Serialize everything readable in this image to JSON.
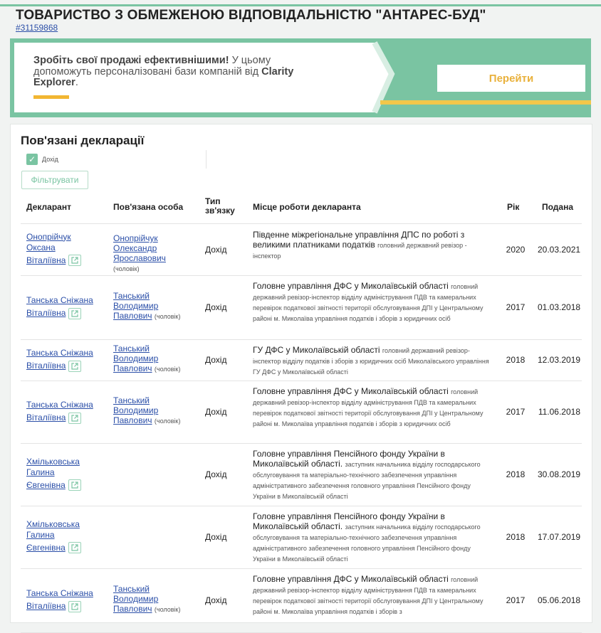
{
  "company": {
    "title": "ТОВАРИСТВО З ОБМЕЖЕНОЮ ВІДПОВІДАЛЬНІСТЮ \"АНТАРЕС-БУД\"",
    "id": "#31159868"
  },
  "banner": {
    "headline": "Зробіть свої продажі ефективнішими!",
    "text": "У цьому допоможуть персоналізовані бази компаній від",
    "brand": "Clarity Explorer",
    "period": ".",
    "button_label": "Перейти"
  },
  "panel": {
    "title": "Пов'язані декларації",
    "filter_checkbox_label": "Дохід",
    "filter_button_label": "Фільтрувати"
  },
  "table": {
    "headers": {
      "declarant": "Декларант",
      "related": "Пов'язана особа",
      "type": "Тип зв'язку",
      "workplace": "Місце роботи декларанта",
      "year": "Рік",
      "submitted": "Подана"
    },
    "rows": [
      {
        "declarant": [
          "Онопрійчук",
          "Оксана",
          "Віталіївна"
        ],
        "related": [
          "Онопрійчук",
          "Олександр",
          "Ярославович"
        ],
        "relation": "(чоловік)",
        "type": "Дохід",
        "workplace": "Південне міжрегіональне управління ДПС по роботі з великими платниками податків",
        "position": "головний державний ревізор - інспектор",
        "year": "2020",
        "date": "20.03.2021"
      },
      {
        "declarant": [
          "Танська Сніжана",
          "Віталіївна"
        ],
        "related": [
          "Танський",
          "Володимир",
          "Павлович"
        ],
        "relation": "(чоловік)",
        "type": "Дохід",
        "workplace": "Головне управління ДФС у Миколаївській області",
        "position": "головний державний ревізор-інспектор відділу адміністрування ПДВ та камеральних перевірок податкової звітності території обслуговування ДПІ у Центральному районі м. Миколаїва управління податків і зборів з юридичних осіб",
        "year": "2017",
        "date": "01.03.2018"
      },
      {
        "declarant": [
          "Танська Сніжана",
          "Віталіївна"
        ],
        "related": [
          "Танський",
          "Володимир",
          "Павлович"
        ],
        "relation": "(чоловік)",
        "type": "Дохід",
        "workplace": "ГУ ДФС у Миколаївській області",
        "position": "головний державний ревізор-інспектор відділу податків і зборів з юридичних осіб Миколаївського управління ГУ ДФС у Миколаївській області",
        "year": "2018",
        "date": "12.03.2019"
      },
      {
        "declarant": [
          "Танська Сніжана",
          "Віталіївна"
        ],
        "related": [
          "Танський",
          "Володимир",
          "Павлович"
        ],
        "relation": "(чоловік)",
        "type": "Дохід",
        "workplace": "Головне управління ДФС у Миколаївській області",
        "position": "головний державний ревізор-інспектор відділу адміністрування ПДВ та камеральних перевірок податкової звітності території обслуговування ДПІ у Центральному районі м. Миколаїва управління податків і зборів з юридичних осіб",
        "year": "2017",
        "date": "11.06.2018"
      },
      {
        "declarant": [
          "Хмільковська",
          "Галина",
          "Євгенівна"
        ],
        "related": [],
        "relation": "",
        "type": "Дохід",
        "workplace": "Головне управління Пенсійного фонду України в Миколаївській області.",
        "position": "заступник начальника відділу господарського обслуговування та матеріально-технічного забезпечення управління адміністративного забезпечення головного управління Пенсійного фонду України в Миколаївській області",
        "year": "2018",
        "date": "30.08.2019"
      },
      {
        "declarant": [
          "Хмільковська",
          "Галина",
          "Євгенівна"
        ],
        "related": [],
        "relation": "",
        "type": "Дохід",
        "workplace": "Головне управління Пенсійного фонду України в Миколаївській області.",
        "position": "заступник начальника відділу господарського обслуговування та матеріально-технічного забезпечення управління адміністративного забезпечення головного управління Пенсійного фонду України в Миколаївській області",
        "year": "2018",
        "date": "17.07.2019"
      },
      {
        "declarant": [
          "Танська Сніжана",
          "Віталіївна"
        ],
        "related": [
          "Танський",
          "Володимир",
          "Павлович"
        ],
        "relation": "(чоловік)",
        "type": "Дохід",
        "workplace": "Головне управління ДФС у Миколаївській області",
        "position": "головний державний ревізор-інспектор відділу адміністрування ПДВ та камеральних перевірок податкової звітності території обслуговування ДПІ у Центральному районі м. Миколаїва управління податків і зборів з",
        "year": "2017",
        "date": "05.06.2018"
      }
    ]
  },
  "colors": {
    "accent_green": "#7ac4a2",
    "button_text": "#e9b13c",
    "link": "#2b4fa8"
  }
}
